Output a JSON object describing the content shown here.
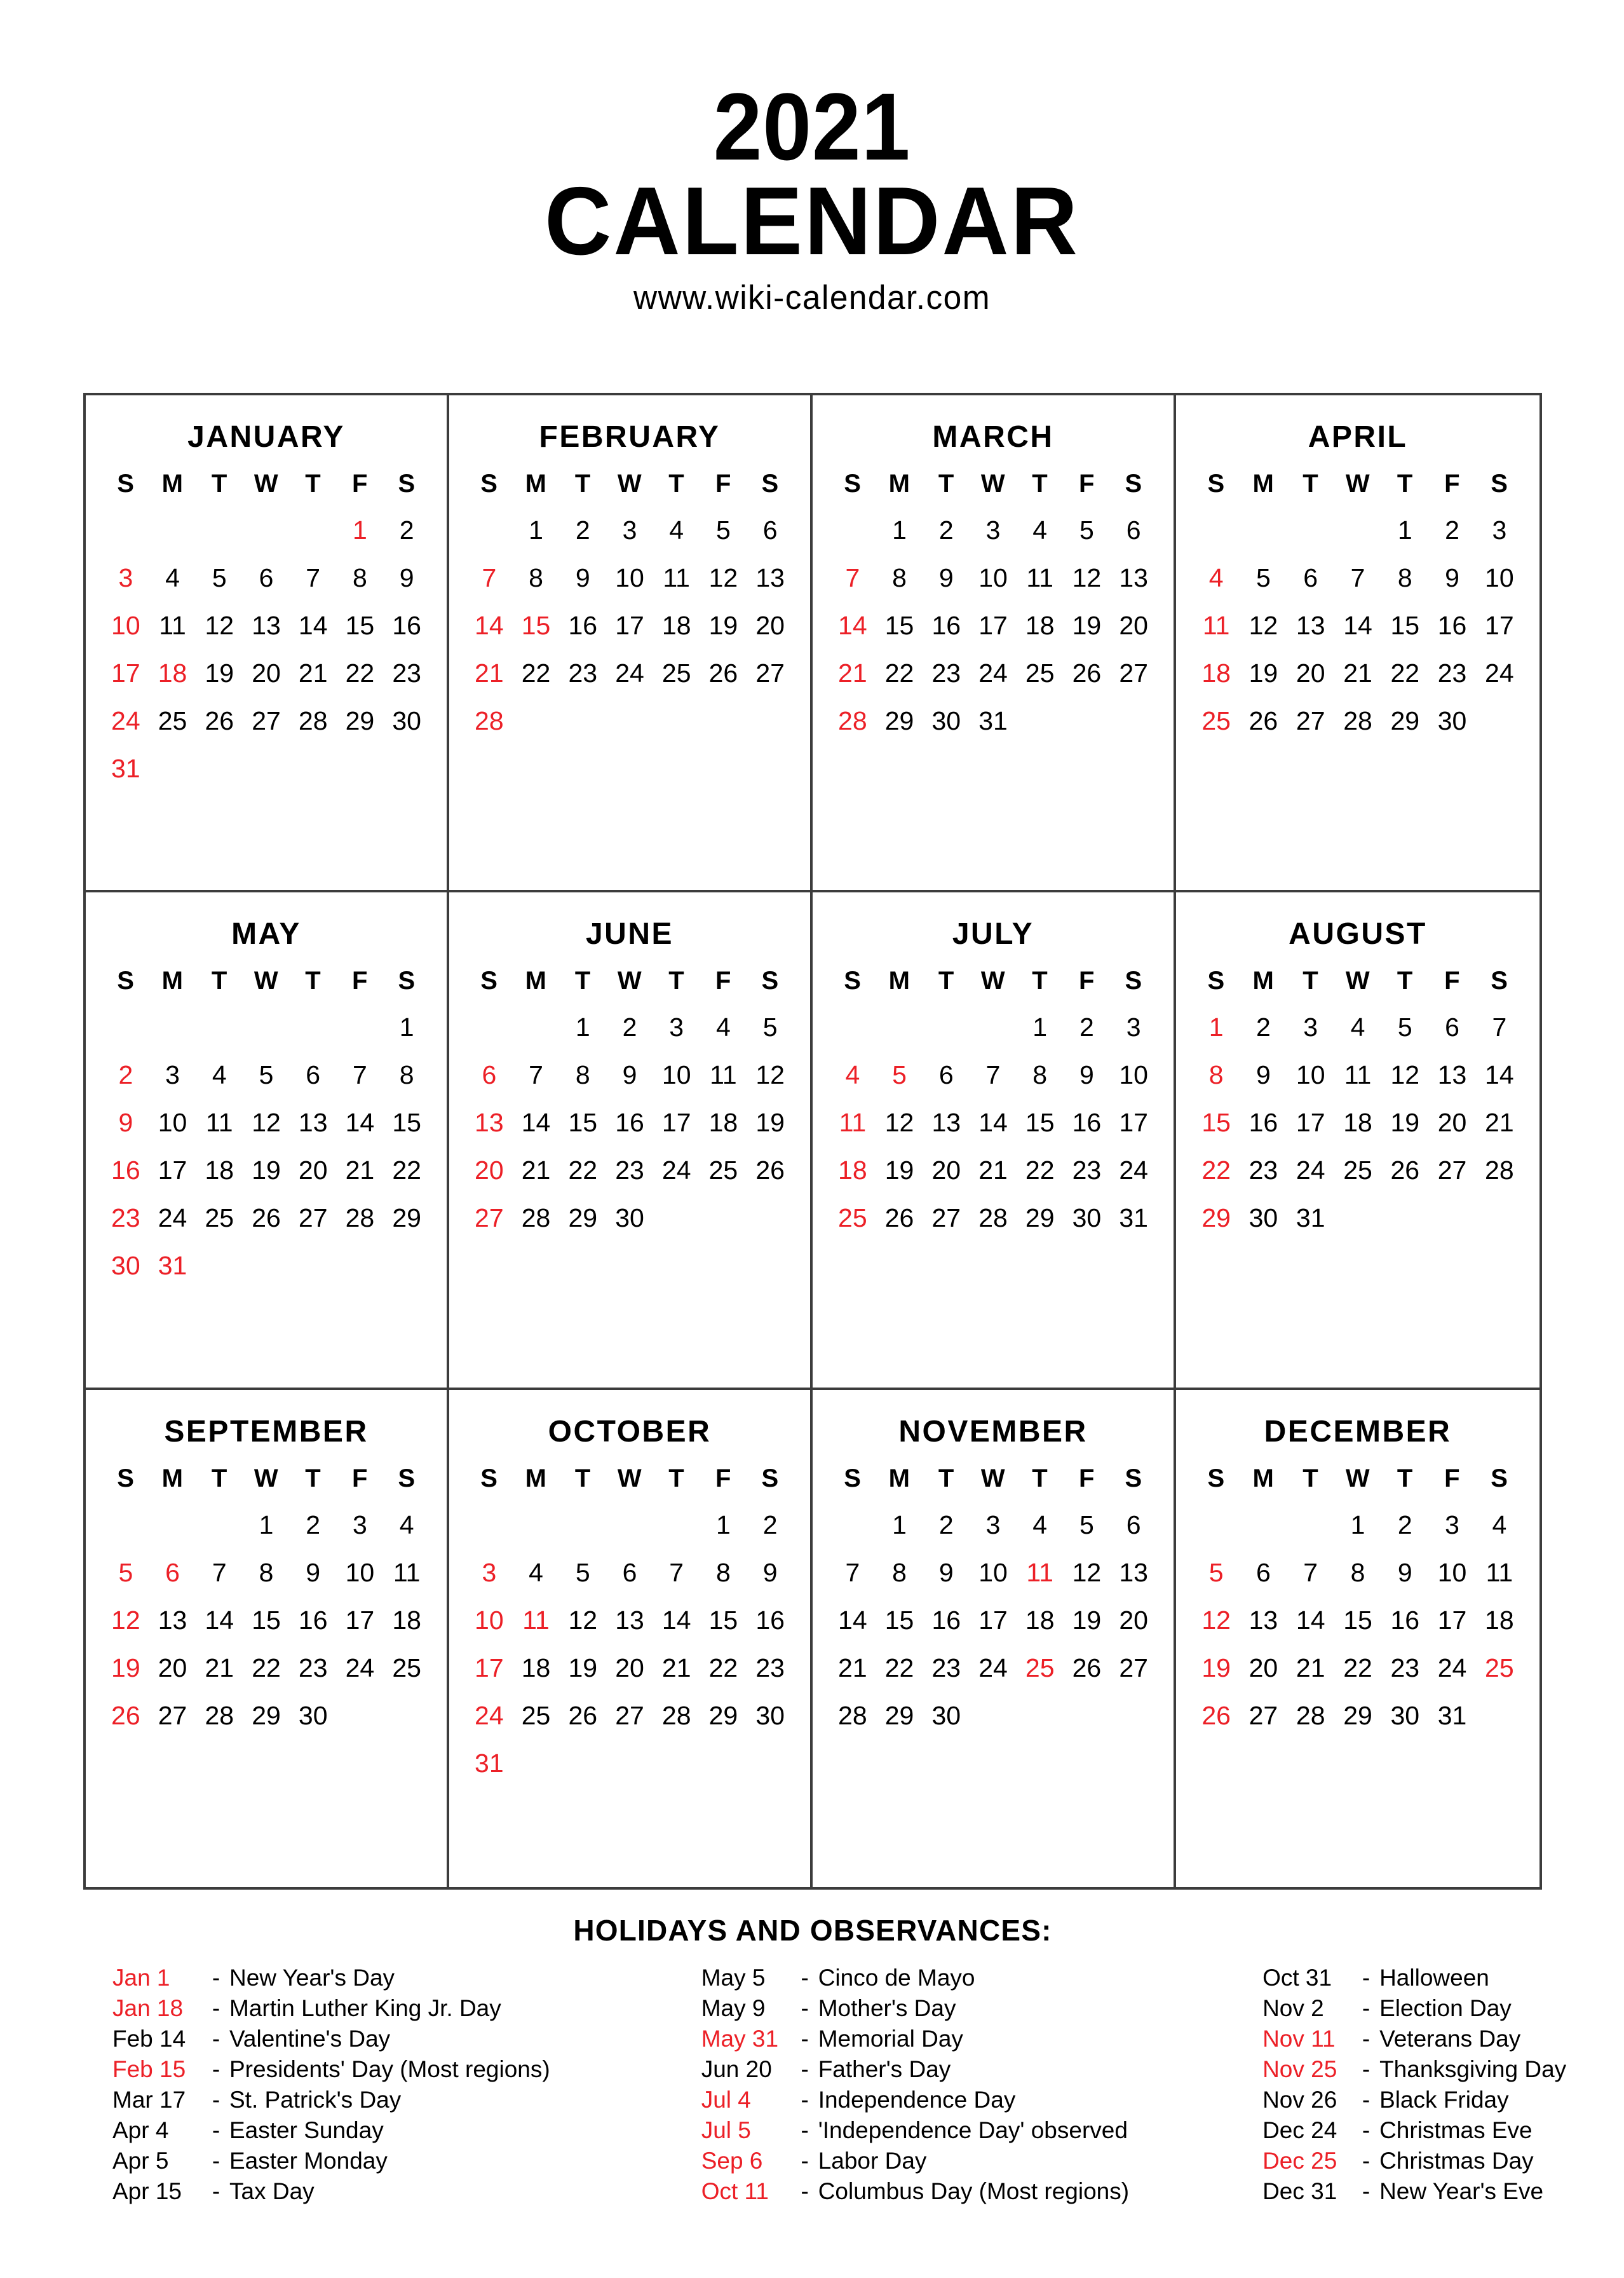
{
  "header": {
    "year": "2021",
    "title": "CALENDAR",
    "url": "www.wiki-calendar.com"
  },
  "colors": {
    "holiday_red": "#EC2027",
    "text_black": "#000000",
    "grid_border": "#3C3C3C",
    "background": "#FFFFFF"
  },
  "weekday_headers": [
    "S",
    "M",
    "T",
    "W",
    "T",
    "F",
    "S"
  ],
  "months": [
    {
      "name": "JANUARY",
      "lead_blanks": 5,
      "days": 31,
      "red_days": [
        1,
        3,
        10,
        17,
        18,
        24,
        31
      ]
    },
    {
      "name": "FEBRUARY",
      "lead_blanks": 1,
      "days": 28,
      "red_days": [
        7,
        14,
        15,
        21,
        28
      ]
    },
    {
      "name": "MARCH",
      "lead_blanks": 1,
      "days": 31,
      "red_days": [
        7,
        14,
        21,
        28
      ]
    },
    {
      "name": "APRIL",
      "lead_blanks": 4,
      "days": 30,
      "red_days": [
        4,
        11,
        18,
        25
      ]
    },
    {
      "name": "MAY",
      "lead_blanks": 6,
      "days": 31,
      "red_days": [
        2,
        9,
        16,
        23,
        30,
        31
      ]
    },
    {
      "name": "JUNE",
      "lead_blanks": 2,
      "days": 30,
      "red_days": [
        6,
        13,
        20,
        27
      ]
    },
    {
      "name": "JULY",
      "lead_blanks": 4,
      "days": 31,
      "red_days": [
        4,
        5,
        11,
        18,
        25
      ]
    },
    {
      "name": "AUGUST",
      "lead_blanks": 0,
      "days": 31,
      "red_days": [
        1,
        8,
        15,
        22,
        29
      ]
    },
    {
      "name": "SEPTEMBER",
      "lead_blanks": 3,
      "days": 30,
      "red_days": [
        5,
        6,
        12,
        19,
        26
      ]
    },
    {
      "name": "OCTOBER",
      "lead_blanks": 5,
      "days": 31,
      "red_days": [
        3,
        10,
        11,
        17,
        24,
        31
      ]
    },
    {
      "name": "NOVEMBER",
      "lead_blanks": 1,
      "days": 30,
      "red_days": [
        11,
        25
      ]
    },
    {
      "name": "DECEMBER",
      "lead_blanks": 3,
      "days": 31,
      "red_days": [
        5,
        12,
        19,
        25,
        26
      ]
    }
  ],
  "holidays": {
    "heading": "HOLIDAYS AND OBSERVANCES:",
    "dash": "-",
    "columns": [
      [
        {
          "date": "Jan 1",
          "label": "New Year's Day",
          "red": true
        },
        {
          "date": "Jan 18",
          "label": "Martin Luther King Jr. Day",
          "red": true
        },
        {
          "date": "Feb 14",
          "label": "Valentine's Day",
          "red": false
        },
        {
          "date": "Feb 15",
          "label": "Presidents' Day (Most regions)",
          "red": true
        },
        {
          "date": "Mar 17",
          "label": "St. Patrick's Day",
          "red": false
        },
        {
          "date": "Apr 4",
          "label": "Easter Sunday",
          "red": false
        },
        {
          "date": "Apr 5",
          "label": "Easter Monday",
          "red": false
        },
        {
          "date": "Apr 15",
          "label": "Tax Day",
          "red": false
        }
      ],
      [
        {
          "date": "May 5",
          "label": "Cinco de Mayo",
          "red": false
        },
        {
          "date": "May 9",
          "label": "Mother's Day",
          "red": false
        },
        {
          "date": "May 31",
          "label": "Memorial Day",
          "red": true
        },
        {
          "date": "Jun 20",
          "label": "Father's Day",
          "red": false
        },
        {
          "date": "Jul 4",
          "label": "Independence Day",
          "red": true
        },
        {
          "date": "Jul 5",
          "label": "'Independence Day' observed",
          "red": true
        },
        {
          "date": "Sep 6",
          "label": "Labor Day",
          "red": true
        },
        {
          "date": "Oct 11",
          "label": "Columbus Day (Most regions)",
          "red": true
        }
      ],
      [
        {
          "date": "Oct 31",
          "label": "Halloween",
          "red": false
        },
        {
          "date": "Nov 2",
          "label": "Election Day",
          "red": false
        },
        {
          "date": "Nov 11",
          "label": "Veterans Day",
          "red": true
        },
        {
          "date": "Nov 25",
          "label": "Thanksgiving Day",
          "red": true
        },
        {
          "date": "Nov 26",
          "label": "Black Friday",
          "red": false
        },
        {
          "date": "Dec 24",
          "label": "Christmas Eve",
          "red": false
        },
        {
          "date": "Dec 25",
          "label": "Christmas Day",
          "red": true
        },
        {
          "date": "Dec 31",
          "label": "New Year's Eve",
          "red": false
        }
      ]
    ]
  }
}
